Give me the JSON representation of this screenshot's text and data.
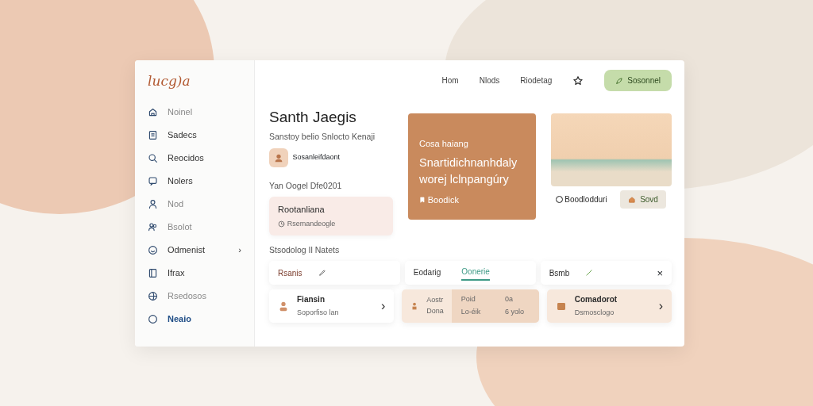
{
  "logo": "lucg)a",
  "sidebar": {
    "items": [
      {
        "label": "Noinel",
        "selected": false,
        "muted": true
      },
      {
        "label": "Sadecs",
        "selected": false,
        "muted": false,
        "chevron": false
      },
      {
        "label": "Reocidos",
        "selected": false,
        "muted": false,
        "chevron": false
      },
      {
        "label": "Nolers",
        "selected": false,
        "muted": false,
        "chevron": false
      },
      {
        "label": "Nod",
        "selected": false,
        "muted": true,
        "chevron": false
      },
      {
        "label": "Bsolot",
        "selected": false,
        "muted": true,
        "chevron": false
      },
      {
        "label": "Odmenist",
        "selected": false,
        "muted": false,
        "chevron": "›"
      },
      {
        "label": "Ifrax",
        "selected": false,
        "muted": false,
        "chevron": false
      },
      {
        "label": "Rsedosos",
        "selected": false,
        "muted": true,
        "chevron": false
      },
      {
        "label": "Neaio",
        "selected": true
      }
    ]
  },
  "topnav": {
    "links": [
      "Hom",
      "Nlods",
      "Riodetag"
    ],
    "button": "Sosonnel"
  },
  "hero": {
    "title": "Santh Jaegis",
    "subtitle": "Sanstoy belio Snlocto Kenaji",
    "profile": "Sosanleifdaont"
  },
  "schedule": {
    "label": "Yan Oogel Dfe0201",
    "card_title": "Rootanliana",
    "card_meta": "Rsemandeogle"
  },
  "feature": {
    "eyebrow": "Cosa haiang",
    "headline": "Snartidichnanhdaly worej lclnpangúry",
    "footer": "Boodick"
  },
  "photo_card": {
    "option": {
      "label": "Boodlodduri",
      "selected": false
    },
    "button": "Sovd"
  },
  "section_title": "Stsodolog Il Natets",
  "filters": [
    {
      "kind": "edit",
      "label": "Rsanis"
    },
    {
      "kind": "tabs",
      "tabs": [
        {
          "label": "Eodarig",
          "selected": false
        },
        {
          "label": "Oonerie",
          "selected": true
        }
      ]
    },
    {
      "kind": "check",
      "label": "Bsmb",
      "close": "×"
    }
  ],
  "cards": [
    {
      "kind": "item",
      "title": "Fiansin",
      "meta": "Soporfiso lan",
      "chevron": "›"
    },
    {
      "kind": "split",
      "left": [
        "Aostr",
        "Dona"
      ],
      "right": [
        [
          "Poid",
          "0a"
        ],
        [
          "Lo-éik",
          "6 yolo"
        ]
      ]
    },
    {
      "kind": "item",
      "title": "Comadorot",
      "meta": "Dsmosclogo",
      "chevron": "›"
    }
  ]
}
